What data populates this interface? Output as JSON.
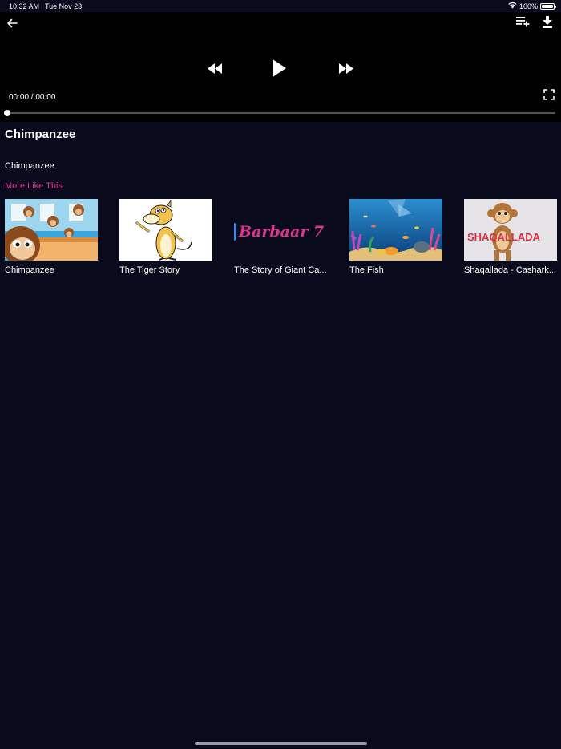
{
  "status_bar": {
    "time": "10:32 AM",
    "date": "Tue Nov 23",
    "battery": "100%",
    "icons": [
      "wifi-icon",
      "battery-icon"
    ]
  },
  "player": {
    "time_readout": "00:00 / 00:00",
    "progress": 0,
    "icons": [
      "back-arrow-icon",
      "playlist-add-icon",
      "download-icon",
      "rewind-icon",
      "play-icon",
      "fast-forward-icon",
      "fullscreen-icon"
    ]
  },
  "video": {
    "title": "Chimpanzee",
    "description": "Chimpanzee"
  },
  "more_like_this": {
    "title": "More Like This",
    "items": [
      {
        "label": "Chimpanzee"
      },
      {
        "label": "The Tiger Story"
      },
      {
        "label": "The Story of Giant Ca...",
        "thumb_text": "Barbaar 7"
      },
      {
        "label": "The Fish"
      },
      {
        "label": "Shaqallada - Cashark...",
        "thumb_text": "SHAQALLADA"
      }
    ]
  },
  "colors": {
    "background": "#090a1c",
    "player_background": "#000000",
    "accent": "#e0338f"
  }
}
